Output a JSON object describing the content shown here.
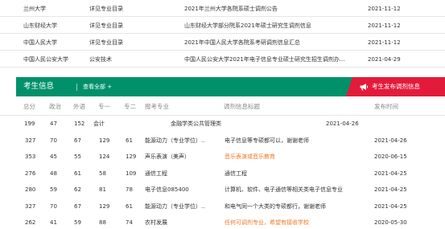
{
  "school_list": [
    {
      "name": "兰州大学",
      "dept": "详见专业目录",
      "title": "2021年兰州大学各院系硕士调剂公告",
      "date": "2021-11-12"
    },
    {
      "name": "山东财经大学",
      "dept": "详见专业目录",
      "title": "山东财经大学部分院系2021年硕士研究生调剂信息",
      "date": "2021-11-12"
    },
    {
      "name": "中国人民大学",
      "dept": "详见专业目录",
      "title": "2021年中国人民大学各院系考研调剂信息汇总",
      "date": "2021-11-12"
    },
    {
      "name": "中国人民公安大学",
      "dept": "公安技术",
      "title": "中国人民公安大学2021年电子信息专业硕士研究生招生调剂办...",
      "date": "2021-04-29"
    }
  ],
  "info_bar": {
    "title": "考生信息",
    "view_all": "查看全部 +",
    "publish_button": "考生发布调剂信息",
    "colors": {
      "bar": "#00916a",
      "publish": "#e31b3b",
      "orange_text": "#ef7a24"
    },
    "publish_icon": "megaphone-icon"
  },
  "table": {
    "headers": [
      "总分",
      "政治",
      "外语",
      "专一",
      "专二",
      "报考专业",
      "调剂信息标题",
      "发布时间"
    ],
    "rows": [
      {
        "total": "199",
        "politics": "47",
        "english": "152",
        "p1": "会计",
        "p2": "",
        "major": "",
        "title": "金融学类公共管理类",
        "date": "2021-04-26",
        "title_orange": false,
        "shifted": true
      },
      {
        "total": "327",
        "politics": "70",
        "english": "67",
        "p1": "129",
        "p2": "61",
        "major": "能源动力（专业学位）..",
        "title": "电子信息等专硕都可以，谢谢老师",
        "date": "2021-04-26",
        "title_orange": false,
        "shifted": false
      },
      {
        "total": "353",
        "politics": "45",
        "english": "55",
        "p1": "124",
        "p2": "129",
        "major": "声乐表演（美声）",
        "title": "音乐表演或音乐教育",
        "date": "2020-06-15",
        "title_orange": true,
        "shifted": false
      },
      {
        "total": "276",
        "politics": "48",
        "english": "61",
        "p1": "58",
        "p2": "109",
        "major": "通信工程",
        "title": "通信工程",
        "date": "2021-04-25",
        "title_orange": false,
        "shifted": false
      },
      {
        "total": "280",
        "politics": "59",
        "english": "62",
        "p1": "81",
        "p2": "78",
        "major": "电子信息085400",
        "title": "计算机、软件、电子通信等相关类电子信息专业",
        "date": "2021-04-25",
        "title_orange": false,
        "shifted": false
      },
      {
        "total": "327",
        "politics": "70",
        "english": "67",
        "p1": "129",
        "p2": "61",
        "major": "能源动力（专业学位）..",
        "title": "和电气同一个大类的专硕都行，谢谢老师",
        "date": "2021-04-25",
        "title_orange": false,
        "shifted": false
      },
      {
        "total": "262",
        "politics": "41",
        "english": "59",
        "p1": "88",
        "p2": "74",
        "major": "农村发展",
        "title": "任何可调剂专业，希望有接收学校",
        "date": "2020-05-30",
        "title_orange": true,
        "shifted": false
      }
    ]
  }
}
